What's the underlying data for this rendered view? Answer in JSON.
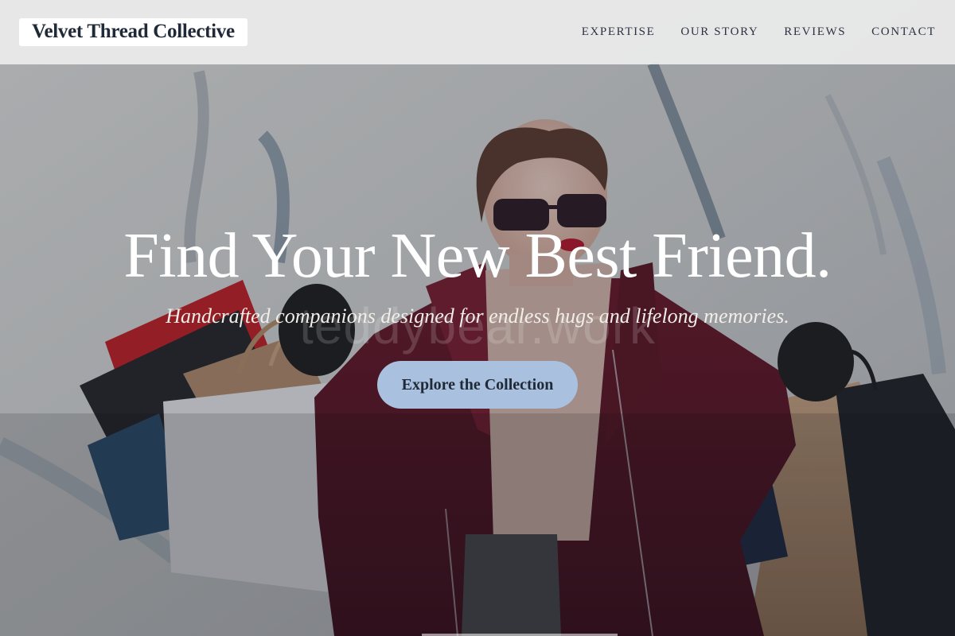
{
  "header": {
    "logo_text": "Velvet Thread Collective",
    "nav": [
      {
        "label": "EXPERTISE"
      },
      {
        "label": "OUR STORY"
      },
      {
        "label": "REVIEWS"
      },
      {
        "label": "CONTACT"
      }
    ]
  },
  "hero": {
    "title": "Find Your New Best Friend.",
    "subtitle": "Handcrafted companions designed for endless hugs and lifelong memories.",
    "cta_label": "Explore the Collection",
    "watermark": "teddybear.work",
    "background_image": "woman-with-shopping-bags-photo"
  },
  "colors": {
    "header_bg": "#ececec",
    "logo_bg": "#ffffff",
    "logo_text": "#1f2937",
    "nav_text": "#2d3340",
    "title_text": "#ffffff",
    "cta_bg": "#a9c1df",
    "cta_text": "#1f2937",
    "coat": "#5a1322"
  }
}
